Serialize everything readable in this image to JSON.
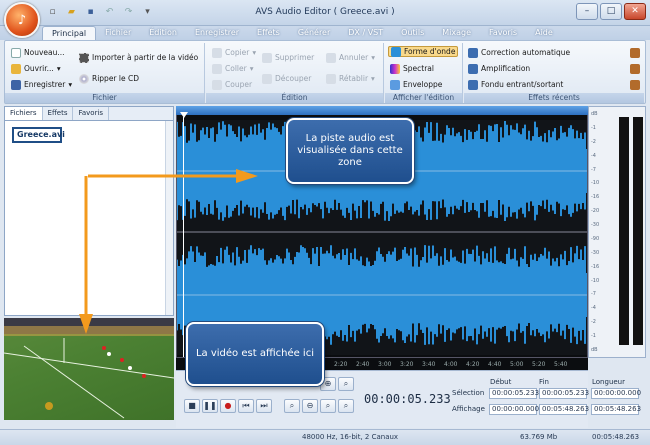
{
  "window": {
    "title": "AVS Audio Editor  ( Greece.avi )",
    "logo_icon": "avs-logo-icon"
  },
  "menu": {
    "tabs": [
      "Principal",
      "Fichier",
      "Édition",
      "Enregistrer",
      "Effets",
      "Générer",
      "DX / VST",
      "Outils",
      "Mixage",
      "Favoris",
      "Aide"
    ],
    "active": "Principal"
  },
  "ribbon": {
    "fichier": {
      "title": "Fichier",
      "nouveau": "Nouveau...",
      "ouvrir": "Ouvrir...",
      "enregistrer": "Enregistrer",
      "importer": "Importer à partir de la vidéo",
      "ripper": "Ripper le CD"
    },
    "edition": {
      "title": "Édition",
      "copier": "Copier",
      "coller": "Coller",
      "couper": "Couper",
      "supprimer": "Supprimer",
      "decouper": "Découper",
      "annuler": "Annuler",
      "retablir": "Rétablir"
    },
    "affichage": {
      "title": "Afficher l'édition",
      "forme": "Forme d'onde",
      "spectral": "Spectral",
      "enveloppe": "Enveloppe"
    },
    "effets": {
      "title": "Effets récents",
      "correction": "Correction automatique",
      "amplification": "Amplification",
      "fondu": "Fondu entrant/sortant"
    }
  },
  "panel": {
    "tabs": [
      "Fichiers",
      "Effets",
      "Favoris"
    ],
    "file": "Greece.avi"
  },
  "db_scale": [
    "dB",
    "-1",
    "-2",
    "-4",
    "-7",
    "-10",
    "-16",
    "-20",
    "-30",
    "-90",
    "-30",
    "-16",
    "-10",
    "-7",
    "-4",
    "-2",
    "-1",
    "dB"
  ],
  "timeline": {
    "ticks": [
      "2:20",
      "2:40",
      "3:00",
      "3:20",
      "3:40",
      "4:00",
      "4:20",
      "4:40",
      "5:00",
      "5:20",
      "5:40"
    ]
  },
  "transport": {
    "time": "00:00:05.233",
    "headers": {
      "debut": "Début",
      "fin": "Fin",
      "longueur": "Longueur"
    },
    "selection": {
      "label": "Sélection",
      "debut": "00:00:05.233",
      "fin": "00:00:05.233",
      "longueur": "00:00:00.000"
    },
    "affichage": {
      "label": "Affichage",
      "debut": "00:00:00.000",
      "fin": "00:05:48.263",
      "longueur": "00:05:48.263"
    }
  },
  "status": {
    "format": "48000 Hz, 16-bit, 2 Canaux",
    "size": "63.769 Mb",
    "duration": "00:05:48.263"
  },
  "callouts": {
    "audio": "La piste audio est visualisée dans cette zone",
    "video": "La vidéo est affichée ici"
  },
  "colors": {
    "accent": "#f39a1d",
    "wave": "#2a8fd8",
    "callout": "#2b5c9c"
  }
}
